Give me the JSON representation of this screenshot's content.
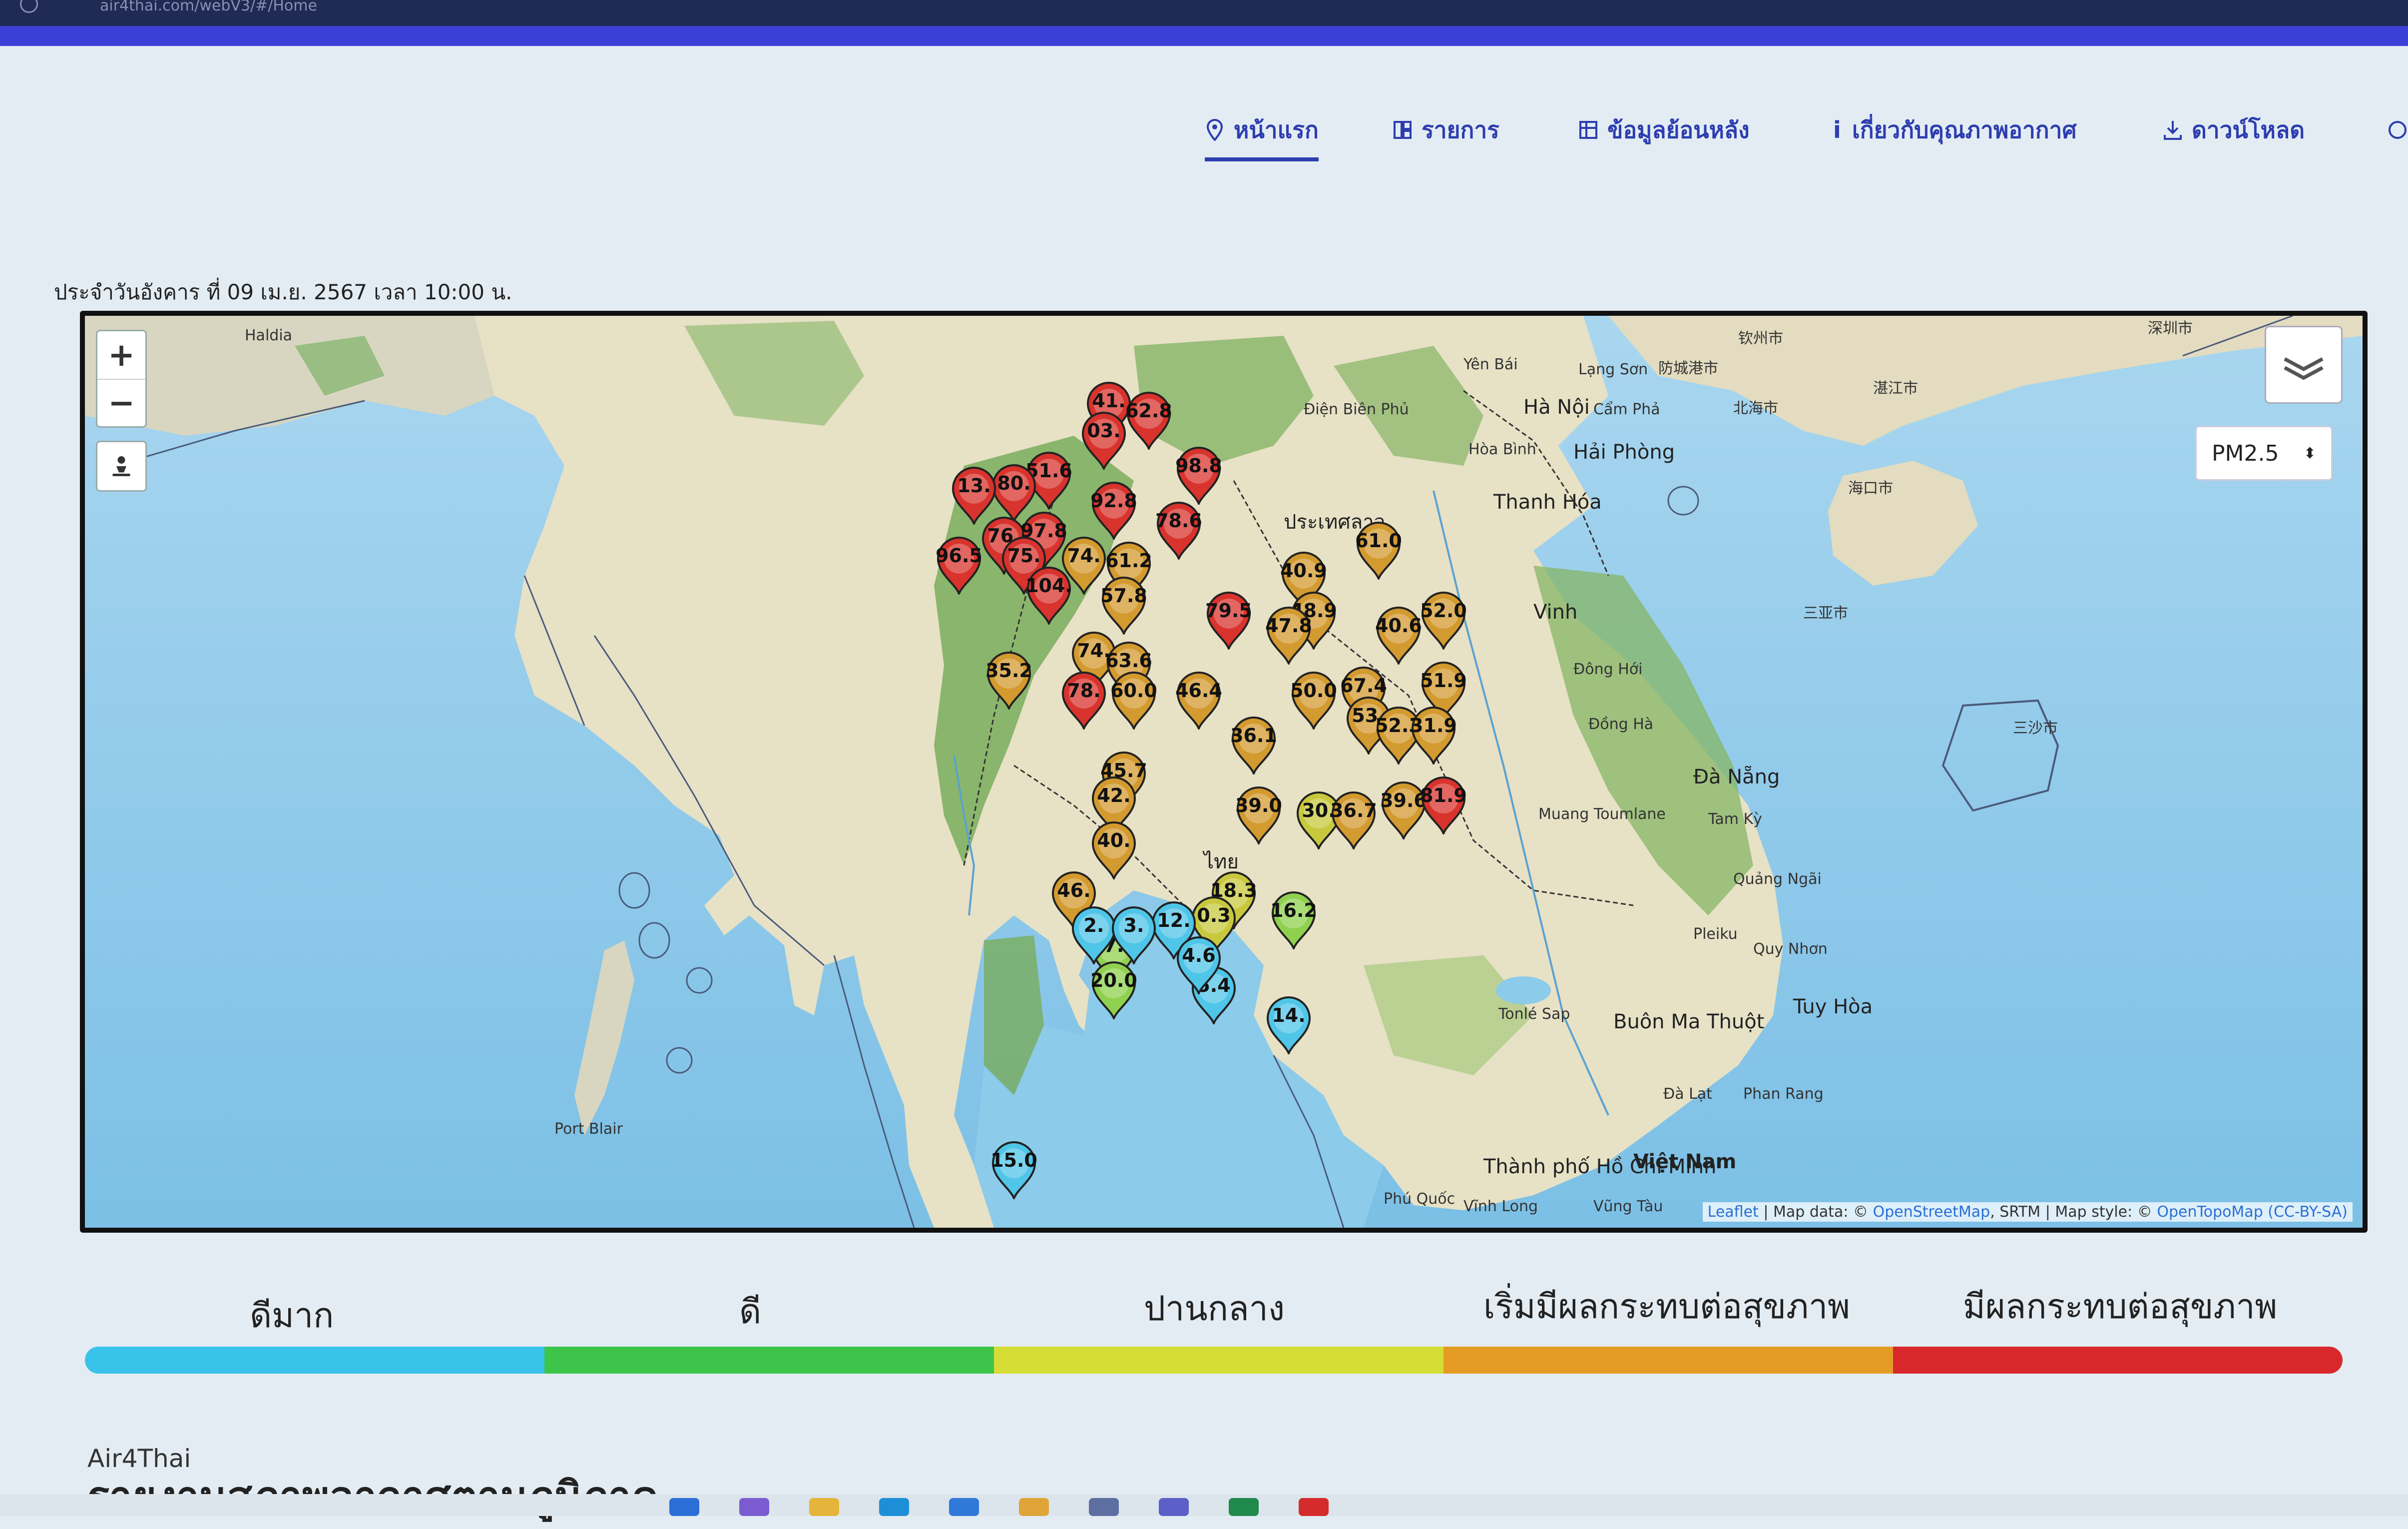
{
  "browser": {
    "url": "air4thai.com/webV3/#/Home"
  },
  "nav": {
    "items": [
      {
        "label": "หน้าแรก",
        "icon": "map-pin-icon",
        "active": true
      },
      {
        "label": "รายการ",
        "icon": "list-icon",
        "active": false
      },
      {
        "label": "ข้อมูลย้อนหลัง",
        "icon": "table-icon",
        "active": false
      },
      {
        "label": "เกี่ยวกับคุณภาพอากาศ",
        "icon": "info-icon",
        "active": false
      },
      {
        "label": "ดาวน์โหลด",
        "icon": "download-icon",
        "active": false
      }
    ]
  },
  "report": {
    "datetime": "ประจำวันอังคาร ที่ 09 เม.ย. 2567 เวลา 10:00 น."
  },
  "map": {
    "zoom_in": "+",
    "zoom_out": "−",
    "pollutant_select": {
      "value": "PM2.5"
    },
    "attribution": {
      "leaflet": "Leaflet",
      "text1": " | Map data: © ",
      "osm": "OpenStreetMap",
      "text2": ", SRTM | Map style: © ",
      "otm": "OpenTopoMap (CC-BY-SA)"
    },
    "place_labels": [
      "Haldia",
      "Port Blair",
      "Thanh Hóa",
      "Hà Nội",
      "Hải Phòng",
      "Vinh",
      "Đông Hới",
      "Đà Nẵng",
      "Quảng Ngãi",
      "Quy Nhơn",
      "Tuy Hòa",
      "Buôn Ma Thuột",
      "Đà Lạt",
      "Phan Rang",
      "Thành phố Hồ Chí Minh",
      "Việt Nam",
      "Phú Quốc",
      "Vĩnh Long",
      "Vũng Tàu",
      "ประเทศลาว",
      "ไทย",
      "海口市",
      "三亚市",
      "湛江市",
      "北海市",
      "钦州市",
      "防城港市",
      "深圳市",
      "三沙市",
      "Cẩm Phả",
      "Lạng Sơn",
      "Yên Bái",
      "Điện Biên Phủ",
      "Hòa Bình",
      "Tam Kỳ",
      "Pleiku",
      "Tonlé Sap",
      "Muang Toumlane",
      "Đồng Hà"
    ],
    "stations": [
      {
        "value": "41.",
        "status": "red"
      },
      {
        "value": "62.8",
        "status": "red"
      },
      {
        "value": "03.",
        "status": "red"
      },
      {
        "value": "98.8",
        "status": "red"
      },
      {
        "value": "51.6",
        "status": "red"
      },
      {
        "value": "80.",
        "status": "red"
      },
      {
        "value": "13.",
        "status": "red"
      },
      {
        "value": "92.8",
        "status": "red"
      },
      {
        "value": "78.6",
        "status": "red"
      },
      {
        "value": "76.",
        "status": "red"
      },
      {
        "value": "97.8",
        "status": "red"
      },
      {
        "value": "96.5",
        "status": "red"
      },
      {
        "value": "75.",
        "status": "red"
      },
      {
        "value": "74.",
        "status": "orange"
      },
      {
        "value": "61.2",
        "status": "orange"
      },
      {
        "value": "104.",
        "status": "red"
      },
      {
        "value": "57.8",
        "status": "orange"
      },
      {
        "value": "61.0",
        "status": "orange"
      },
      {
        "value": "40.9",
        "status": "orange"
      },
      {
        "value": "79.5",
        "status": "red"
      },
      {
        "value": "48.9",
        "status": "orange"
      },
      {
        "value": "47.8",
        "status": "orange"
      },
      {
        "value": "40.6",
        "status": "orange"
      },
      {
        "value": "52.0",
        "status": "orange"
      },
      {
        "value": "74.",
        "status": "orange"
      },
      {
        "value": "63.6",
        "status": "orange"
      },
      {
        "value": "35.2",
        "status": "orange"
      },
      {
        "value": "78.",
        "status": "red"
      },
      {
        "value": "60.0",
        "status": "orange"
      },
      {
        "value": "46.4",
        "status": "orange"
      },
      {
        "value": "50.0",
        "status": "orange"
      },
      {
        "value": "67.4",
        "status": "orange"
      },
      {
        "value": "51.9",
        "status": "orange"
      },
      {
        "value": "53.",
        "status": "orange"
      },
      {
        "value": "52.3",
        "status": "orange"
      },
      {
        "value": "31.9",
        "status": "orange"
      },
      {
        "value": "36.1",
        "status": "orange"
      },
      {
        "value": "45.7",
        "status": "orange"
      },
      {
        "value": "42.",
        "status": "orange"
      },
      {
        "value": "39.0",
        "status": "orange"
      },
      {
        "value": "30.",
        "status": "yellow"
      },
      {
        "value": "36.7",
        "status": "orange"
      },
      {
        "value": "39.6",
        "status": "orange"
      },
      {
        "value": "81.9",
        "status": "red"
      },
      {
        "value": "40.",
        "status": "orange"
      },
      {
        "value": "46.",
        "status": "orange"
      },
      {
        "value": "18.3",
        "status": "yellow"
      },
      {
        "value": "16.2",
        "status": "green"
      },
      {
        "value": "17.5",
        "status": "green"
      },
      {
        "value": "20.0",
        "status": "green"
      },
      {
        "value": "5.4",
        "status": "blue"
      },
      {
        "value": "14.",
        "status": "blue"
      },
      {
        "value": "15.0",
        "status": "blue"
      },
      {
        "value": "0.3",
        "status": "yellow"
      },
      {
        "value": "2.",
        "status": "blue"
      },
      {
        "value": "12.",
        "status": "blue"
      },
      {
        "value": "3.",
        "status": "blue"
      },
      {
        "value": "4.6",
        "status": "blue"
      }
    ]
  },
  "legend": [
    {
      "label": "ดีมาก",
      "color": "#38c3ea"
    },
    {
      "label": "ดี",
      "color": "#3ec44a"
    },
    {
      "label": "ปานกลาง",
      "color": "#d6dd35"
    },
    {
      "label": "เริ่มมีผลกระทบต่อสุขภาพ",
      "color": "#e49c24"
    },
    {
      "label": "มีผลกระทบต่อสุขภาพ",
      "color": "#d9282c"
    }
  ],
  "status_colors": {
    "red": "#d8332d",
    "orange": "#d39a2f",
    "yellow": "#c8c83e",
    "green": "#8fd04e",
    "blue": "#4fc5e8"
  },
  "footer": {
    "app_name": "Air4Thai",
    "section_title": "รายงานสภาพอากาศตามภูมิภาค"
  },
  "taskbar": {
    "icons": [
      "search-icon",
      "chat-icon",
      "folder-icon",
      "edge-icon",
      "store-icon",
      "chrome-icon",
      "app-icon",
      "teams-icon",
      "excel-icon",
      "acrobat-icon"
    ]
  }
}
